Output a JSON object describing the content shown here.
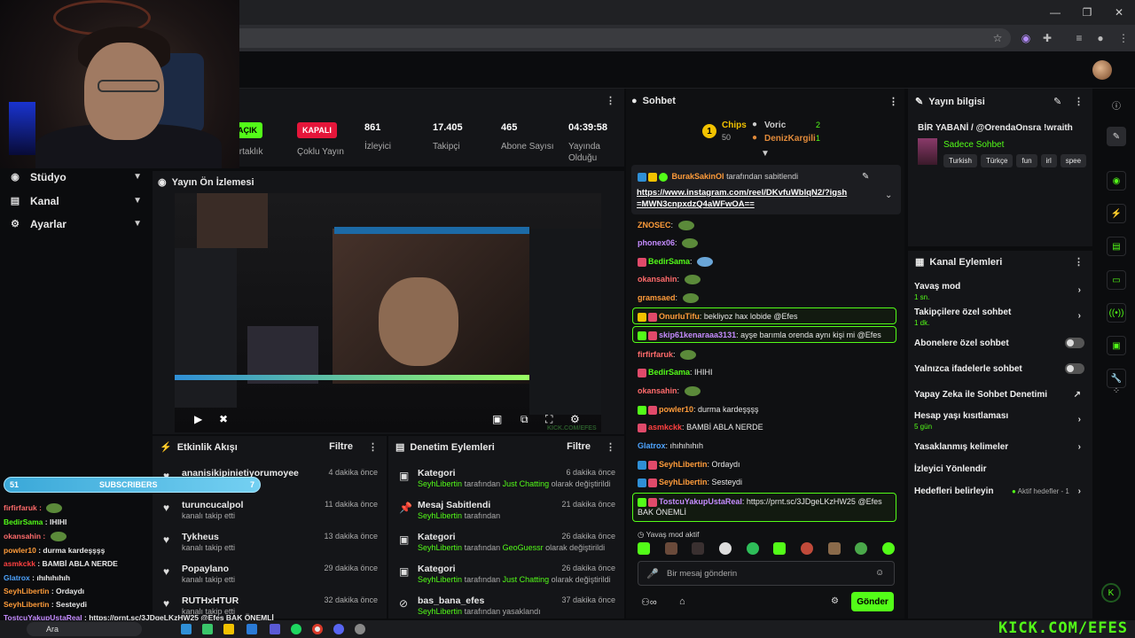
{
  "sidebar": {
    "items": [
      {
        "label": "Stüdyo"
      },
      {
        "label": "Kanal"
      },
      {
        "label": "Ayarlar"
      }
    ]
  },
  "stats": {
    "affiliate_badge": "AÇIK",
    "affiliate_label": "Ortaklık",
    "multistream_badge": "KAPALI",
    "multistream_label": "Çoklu Yayın",
    "viewers": "861",
    "viewers_label": "İzleyici",
    "followers": "17.405",
    "followers_label": "Takipçi",
    "subs": "465",
    "subs_label": "Abone Sayısı",
    "uptime": "04:39:58",
    "uptime_label": "Yayında Olduğu"
  },
  "preview": {
    "title": "Yayın Ön İzlemesi",
    "watermark": "KICK.COM/EFES"
  },
  "activity": {
    "title": "Etkinlik Akışı",
    "filter": "Filtre",
    "rows": [
      {
        "name": "ananisikipinietiyorumoyee",
        "sub": "",
        "time": "4 dakika önce"
      },
      {
        "name": "turuncucalpol",
        "sub": "kanalı takip etti",
        "time": "11 dakika önce"
      },
      {
        "name": "Tykheus",
        "sub": "kanalı takip etti",
        "time": "13 dakika önce"
      },
      {
        "name": "Popaylano",
        "sub": "kanalı takip etti",
        "time": "29 dakika önce"
      },
      {
        "name": "RUTHxHTUR",
        "sub": "kanalı takip etti",
        "time": "32 dakika önce"
      }
    ]
  },
  "modlog": {
    "title": "Denetim Eylemleri",
    "filter": "Filtre",
    "rows": [
      {
        "name": "Kategori",
        "user": "SeyhLibertin",
        "mid": "tarafından",
        "hl": "Just Chatting",
        "end": "olarak değiştirildi",
        "time": "6 dakika önce"
      },
      {
        "name": "Mesaj Sabitlendi",
        "user": "SeyhLibertin",
        "mid": "tarafından",
        "hl": "",
        "end": "",
        "time": "21 dakika önce"
      },
      {
        "name": "Kategori",
        "user": "SeyhLibertin",
        "mid": "tarafından",
        "hl": "GeoGuessr",
        "end": "olarak değiştirildi",
        "time": "26 dakika önce"
      },
      {
        "name": "Kategori",
        "user": "SeyhLibertin",
        "mid": "tarafından",
        "hl": "Just Chatting",
        "end": "olarak değiştirildi",
        "time": "26 dakika önce"
      },
      {
        "name": "bas_bana_efes",
        "user": "SeyhLibertin",
        "mid": "tarafından yasaklandı",
        "hl": "",
        "end": "",
        "time": "37 dakika önce"
      }
    ]
  },
  "chat": {
    "title": "Sohbet",
    "leaders": {
      "chips_name": "Chips",
      "chips_value": "50",
      "voric_name": "Voric",
      "voric_value": "2",
      "deniz_name": "DenizKargili",
      "deniz_value": "1"
    },
    "pinned": {
      "user": "BurakSakinOl",
      "suffix": "tarafından sabitlendi",
      "link": "https://www.instagram.com/reel/DKvfuWblqN2/?igsh=MWN3cnpxdzQ4aWFwOA=="
    },
    "messages": [
      {
        "user": "ZNOSEC",
        "text": "",
        "color": "#ff9c3a"
      },
      {
        "user": "phonex06",
        "text": "",
        "color": "#c58cff"
      },
      {
        "user": "BedirSama",
        "text": "",
        "color": "#53fc18"
      },
      {
        "user": "okansahin",
        "text": "",
        "color": "#ff6b6b"
      },
      {
        "user": "gramsaed",
        "text": "",
        "color": "#ff9c3a"
      },
      {
        "user": "OnurluTifu",
        "text": "bekliyoz hax lobide @Efes",
        "color": "#ff9c3a"
      },
      {
        "user": "skip61kenaraaa3131",
        "text": "ayşe barımla orenda aynı kişi mi @Efes",
        "color": "#c58cff"
      },
      {
        "user": "firfirfaruk",
        "text": "",
        "color": "#ff6b6b"
      },
      {
        "user": "BedirSama",
        "text": "IHIHI",
        "color": "#53fc18"
      },
      {
        "user": "okansahin",
        "text": "",
        "color": "#ff6b6b"
      },
      {
        "user": "powler10",
        "text": "durma kardeşşşş",
        "color": "#ff9c3a"
      },
      {
        "user": "asmkckk",
        "text": "BAMBİ ABLA NERDE",
        "color": "#ff4040"
      },
      {
        "user": "Glatrox",
        "text": "ıhıhıhıhıh",
        "color": "#4ea4ff"
      },
      {
        "user": "SeyhLibertin",
        "text": "Ordaydı",
        "color": "#ff9c3a"
      },
      {
        "user": "SeyhLibertin",
        "text": "Sesteydi",
        "color": "#ff9c3a"
      },
      {
        "user": "TostcuYakupUstaReal",
        "text": "https://prnt.sc/3JDgeLKzHW25 @Efes BAK ÖNEMLİ",
        "color": "#c58cff"
      }
    ],
    "slow_mode": "Yavaş mod aktif",
    "input_placeholder": "Bir mesaj gönderin",
    "send": "Gönder"
  },
  "streaminfo": {
    "title": "Yayın bilgisi",
    "stream_title": "BİR YABANİ / @OrendaOnsra !wraith",
    "category": "Sadece Sohbet",
    "tags": [
      "Turkish",
      "Türkçe",
      "fun",
      "irl",
      "spee"
    ]
  },
  "channelactions": {
    "title": "Kanal Eylemleri",
    "rows": [
      {
        "label": "Yavaş mod",
        "sub": "1 sn."
      },
      {
        "label": "Takipçilere özel sohbet",
        "sub": "1 dk."
      },
      {
        "label": "Abonelere özel sohbet",
        "sub": ""
      },
      {
        "label": "Yalnızca ifadelerle sohbet",
        "sub": ""
      },
      {
        "label": "Yapay Zeka ile Sohbet Denetimi",
        "sub": ""
      },
      {
        "label": "Hesap yaşı kısıtlaması",
        "sub": "5 gün"
      },
      {
        "label": "Yasaklanmış kelimeler",
        "sub": ""
      },
      {
        "label": "İzleyici Yönlendir",
        "sub": ""
      },
      {
        "label": "Hedefleri belirleyin",
        "sub": ""
      }
    ],
    "goals_status": "Aktif hedefler - 1"
  },
  "overlay": {
    "subs_count": "51",
    "subs_label": "SUBSCRIBERS",
    "subs_goal": "7",
    "lines": [
      {
        "user": "firfirfaruk",
        "text": ""
      },
      {
        "user": "BedirSama",
        "text": "IHIHI"
      },
      {
        "user": "okansahin",
        "text": ""
      },
      {
        "user": "powler10",
        "text": "durma kardeşşşş"
      },
      {
        "user": "asmkckk",
        "text": "BAMBİ ABLA NERDE"
      },
      {
        "user": "Glatrox",
        "text": "ıhıhıhıhıh"
      },
      {
        "user": "SeyhLibertin",
        "text": "Ordaydı"
      },
      {
        "user": "SeyhLibertin",
        "text": "Sesteydi"
      },
      {
        "user": "TostcuYakupUstaReal",
        "text": "https://prnt.sc/3JDgeLKzHW25 @Efes BAK ÖNEMLİ"
      }
    ]
  },
  "taskbar": {
    "search": "Ara",
    "watermark": "KICK.COM/EFES"
  },
  "colors": {
    "accent": "#53fc18",
    "panel": "#141518",
    "background": "#0b0c0e",
    "multistream_off": "#e5163a"
  }
}
